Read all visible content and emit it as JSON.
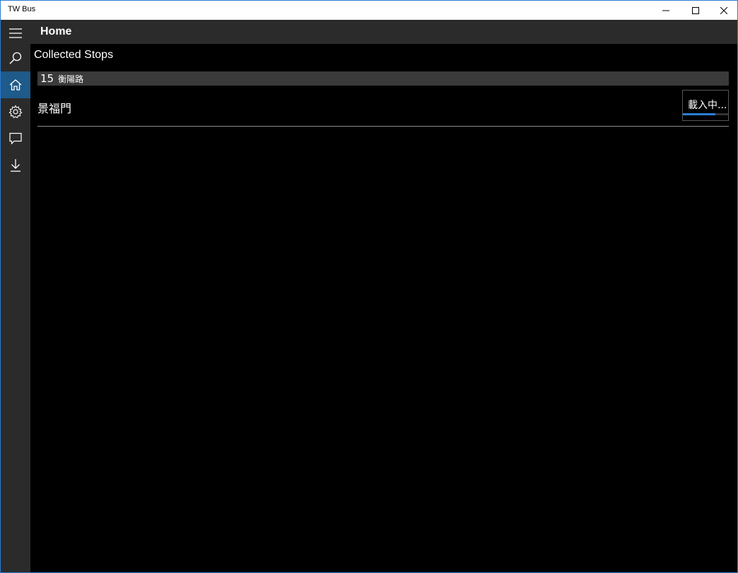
{
  "window": {
    "title": "TW Bus",
    "controls": {
      "minimize_icon": "minimize-icon",
      "maximize_icon": "maximize-icon",
      "close_icon": "close-icon"
    }
  },
  "nav": {
    "items": [
      {
        "icon": "hamburger-menu-icon",
        "selected": false
      },
      {
        "icon": "search-icon",
        "selected": false
      },
      {
        "icon": "home-icon",
        "selected": true
      },
      {
        "icon": "gear-icon",
        "selected": false
      },
      {
        "icon": "chat-icon",
        "selected": false
      },
      {
        "icon": "download-icon",
        "selected": false
      }
    ]
  },
  "header": {
    "title": "Home"
  },
  "main": {
    "section_title": "Collected Stops",
    "groups": [
      {
        "route_number": "15",
        "route_name": "衡陽路",
        "stops": [
          {
            "name": "景福門",
            "status": "載入中...",
            "progress": 0.72
          }
        ]
      }
    ]
  },
  "colors": {
    "accent": "#2a7fd4",
    "selected_nav": "#1e5a8a",
    "chrome": "#2b2b2b",
    "group_header": "#3a3a3a",
    "window_border": "#2b7bd3"
  }
}
